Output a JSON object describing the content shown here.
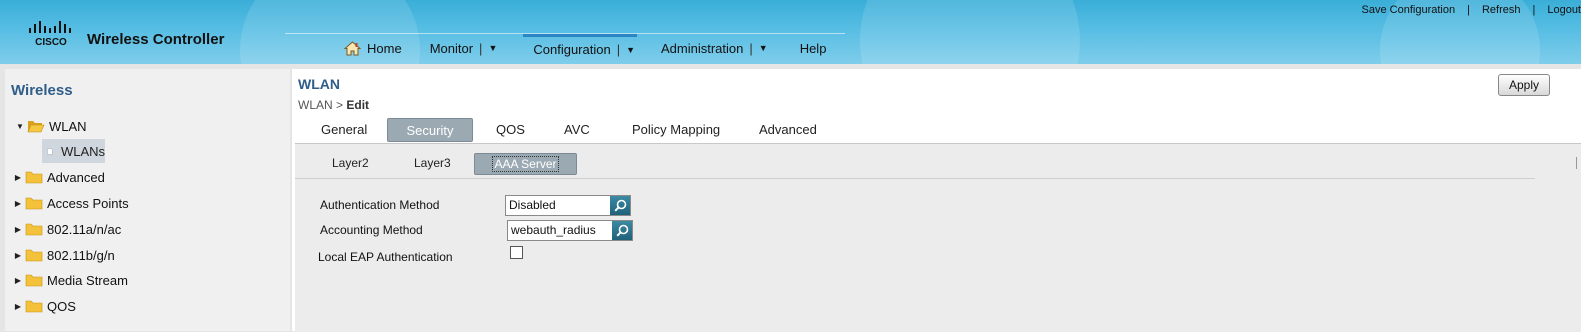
{
  "header": {
    "brand_title": "Wireless Controller",
    "logo_text": "CISCO",
    "utility_links": [
      "Save Configuration",
      "Refresh",
      "Logout"
    ],
    "nav": [
      {
        "label": "Home",
        "icon": "home-icon",
        "dropdown": false
      },
      {
        "label": "Monitor",
        "dropdown": true
      },
      {
        "label": "Configuration",
        "dropdown": true,
        "active": true
      },
      {
        "label": "Administration",
        "dropdown": true
      },
      {
        "label": "Help",
        "dropdown": false
      }
    ]
  },
  "sidebar": {
    "title": "Wireless",
    "tree": [
      {
        "label": "WLAN",
        "expanded": true,
        "icon": "folder-open-icon"
      },
      {
        "label": "WLANs",
        "child": true,
        "selected": true,
        "icon": "document-icon"
      },
      {
        "label": "Advanced",
        "icon": "folder-icon"
      },
      {
        "label": "Access Points",
        "icon": "folder-icon"
      },
      {
        "label": "802.11a/n/ac",
        "icon": "folder-icon"
      },
      {
        "label": "802.11b/g/n",
        "icon": "folder-icon"
      },
      {
        "label": "Media Stream",
        "icon": "folder-icon"
      },
      {
        "label": "QOS",
        "icon": "folder-icon"
      }
    ]
  },
  "main": {
    "title": "WLAN",
    "breadcrumb": {
      "parent": "WLAN",
      "separator": ">",
      "current": "Edit"
    },
    "apply_label": "Apply",
    "tabs": [
      "General",
      "Security",
      "QOS",
      "AVC",
      "Policy Mapping",
      "Advanced"
    ],
    "active_tab": "Security",
    "subtabs": [
      "Layer2",
      "Layer3",
      "AAA Server"
    ],
    "active_subtab": "AAA Server",
    "form": {
      "auth_method_label": "Authentication Method",
      "auth_method_value": "Disabled",
      "acct_method_label": "Accounting Method",
      "acct_method_value": "webauth_radius",
      "local_eap_label": "Local EAP Authentication",
      "local_eap_checked": false
    }
  },
  "colors": {
    "header_blue": "#3aaed8",
    "title_blue": "#2f5d89",
    "active_tab": "#9ba9b3",
    "search_button": "#1f6179",
    "folder_yellow": "#f3c13a"
  }
}
